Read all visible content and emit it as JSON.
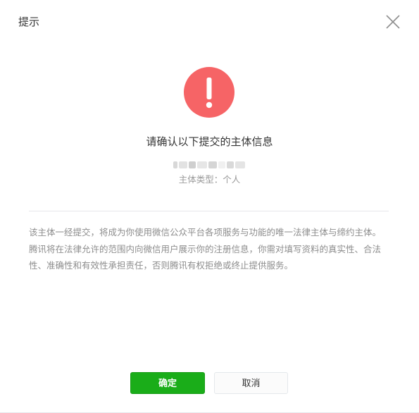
{
  "dialog": {
    "title": "提示",
    "close_icon": "close-icon",
    "alert_icon": "exclamation-circle-icon",
    "alert_color": "#f66466",
    "headline": "请确认以下提交的主体信息",
    "subject_type_text": "主体类型：个人",
    "notice": "该主体一经提交，将成为你使用微信公众平台各项服务与功能的唯一法律主体与缔约主体。 腾讯将在法律允许的范围内向微信用户展示你的注册信息，你需对填写资料的真实性、合法性、准确性和有效性承担责任，否则腾讯有权拒绝或终止提供服务。",
    "confirm_label": "确定",
    "cancel_label": "取消",
    "accent_color": "#1aad19"
  }
}
